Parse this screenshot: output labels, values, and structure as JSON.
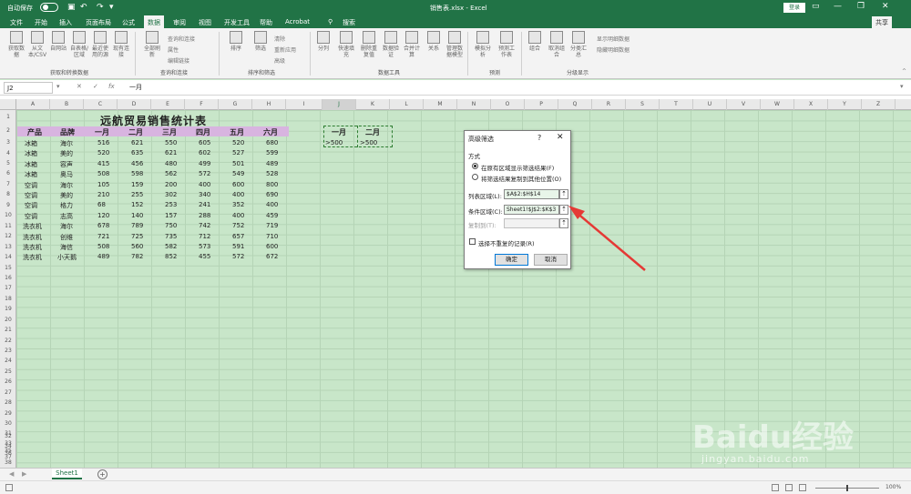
{
  "titlebar": {
    "autosave_label": "自动保存",
    "doc_title": "销售表.xlsx  -  Excel",
    "login_label": "登录"
  },
  "tabs": [
    "文件",
    "开始",
    "插入",
    "页面布局",
    "公式",
    "数据",
    "审阅",
    "视图",
    "开发工具",
    "帮助",
    "Acrobat",
    "搜索"
  ],
  "active_tab": "数据",
  "share_label": "共享",
  "ribbon": {
    "buttons": [
      "获取数据",
      "从文本/CSV",
      "自网站",
      "自表格/区域",
      "最近使用的源",
      "现有连接",
      "全部刷新",
      "排序",
      "筛选",
      "分列",
      "快速填充",
      "删除重复值",
      "数据验证",
      "合并计算",
      "关系",
      "管理数据模型",
      "模拟分析",
      "预测工作表",
      "组合",
      "取消组合",
      "分类汇总"
    ],
    "small_items": [
      "查询和连接",
      "属性",
      "编辑链接",
      "清除",
      "重新应用",
      "高级",
      "显示明细数据",
      "隐藏明细数据"
    ],
    "groups": [
      "获取和转换数据",
      "查询和连接",
      "排序和筛选",
      "数据工具",
      "预测",
      "分级显示"
    ]
  },
  "formula_bar": {
    "name_box": "J2",
    "formula": "一月"
  },
  "columns": [
    "A",
    "B",
    "C",
    "D",
    "E",
    "F",
    "G",
    "H",
    "I",
    "J",
    "K",
    "L",
    "M",
    "N",
    "O",
    "P",
    "Q",
    "R",
    "S",
    "T",
    "U",
    "V",
    "W",
    "X",
    "Y",
    "Z"
  ],
  "rows": [
    "1",
    "2",
    "3",
    "4",
    "5",
    "6",
    "7",
    "8",
    "9",
    "10",
    "11",
    "12",
    "13",
    "14",
    "15",
    "16",
    "17",
    "18",
    "19",
    "20",
    "21",
    "22",
    "23",
    "24",
    "25",
    "26",
    "27",
    "28",
    "29",
    "30",
    "31",
    "32",
    "33",
    "34",
    "35",
    "36",
    "37",
    "38"
  ],
  "sheet": {
    "title": "远航贸易销售统计表",
    "headers": [
      "产品",
      "品牌",
      "一月",
      "二月",
      "三月",
      "四月",
      "五月",
      "六月"
    ],
    "data": [
      [
        "冰箱",
        "海尔",
        "516",
        "621",
        "550",
        "605",
        "520",
        "680"
      ],
      [
        "冰箱",
        "美的",
        "520",
        "635",
        "621",
        "602",
        "527",
        "599"
      ],
      [
        "冰箱",
        "容声",
        "415",
        "456",
        "480",
        "499",
        "501",
        "489"
      ],
      [
        "冰箱",
        "奥马",
        "508",
        "598",
        "562",
        "572",
        "549",
        "528"
      ],
      [
        "空调",
        "海尔",
        "105",
        "159",
        "200",
        "400",
        "600",
        "800"
      ],
      [
        "空调",
        "美的",
        "210",
        "255",
        "302",
        "340",
        "400",
        "690"
      ],
      [
        "空调",
        "格力",
        "68",
        "152",
        "253",
        "241",
        "352",
        "400"
      ],
      [
        "空调",
        "志高",
        "120",
        "140",
        "157",
        "288",
        "400",
        "459"
      ],
      [
        "洗衣机",
        "海尔",
        "678",
        "789",
        "750",
        "742",
        "752",
        "719"
      ],
      [
        "洗衣机",
        "创维",
        "721",
        "725",
        "735",
        "712",
        "657",
        "710"
      ],
      [
        "洗衣机",
        "海信",
        "508",
        "560",
        "582",
        "573",
        "591",
        "600"
      ],
      [
        "洗衣机",
        "小天鹅",
        "489",
        "782",
        "852",
        "455",
        "572",
        "672"
      ]
    ],
    "criteria": {
      "headers": [
        "一月",
        "二月"
      ],
      "values": [
        ">500",
        ">500"
      ]
    }
  },
  "dialog": {
    "title": "高级筛选",
    "help": "?",
    "section": "方式",
    "option1": "在原有区域显示筛选结果(F)",
    "option2": "将筛选结果复制到其他位置(O)",
    "list_range_label": "列表区域(L):",
    "list_range_value": "$A$2:$H$14",
    "criteria_range_label": "条件区域(C):",
    "criteria_range_value": "Sheet1!$J$2:$K$3",
    "copy_to_label": "复制到(T):",
    "copy_to_value": "",
    "unique_label": "选择不重复的记录(R)",
    "ok_label": "确定",
    "cancel_label": "取消"
  },
  "sheet_tab": "Sheet1",
  "status": {
    "zoom": "100%"
  },
  "watermark": {
    "logo": "Baidu经验",
    "url": "jingyan.baidu.com"
  },
  "colors": {
    "excel_green": "#217346",
    "sheet_bg": "#c8e6c9",
    "header_band": "#d8b4e0",
    "arrow": "#e53935"
  }
}
